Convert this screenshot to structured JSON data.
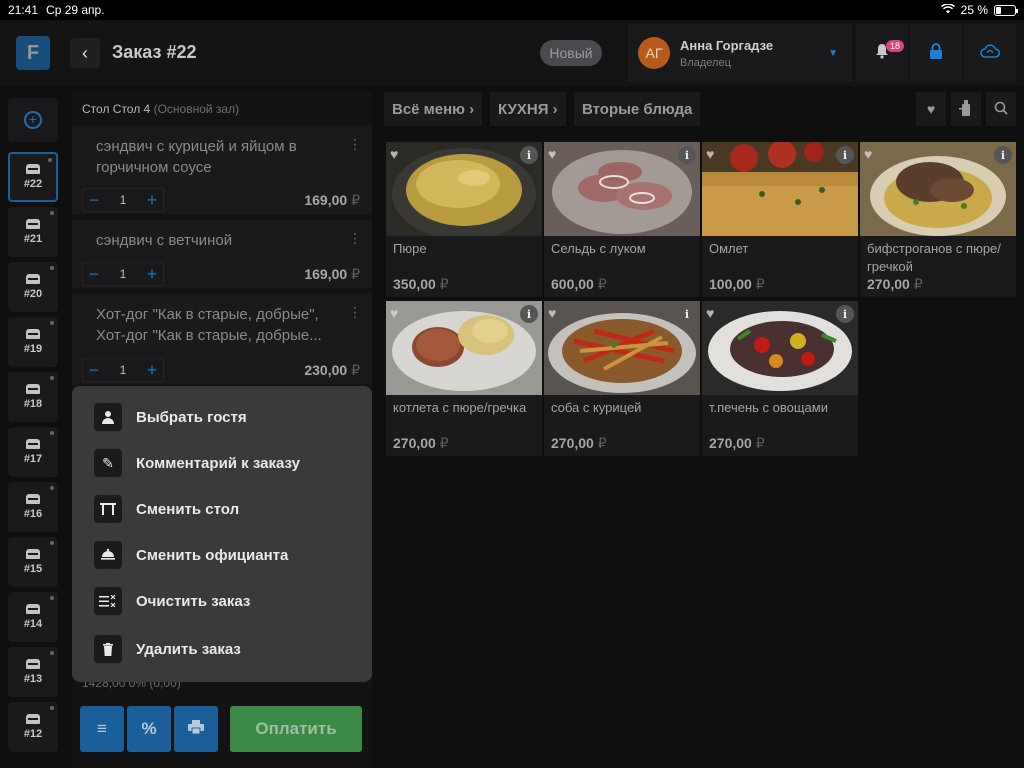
{
  "status_bar": {
    "time": "21:41",
    "date": "Ср 29 апр.",
    "battery": "25 %"
  },
  "header": {
    "logo_letter": "F",
    "back_label": "‹",
    "title": "Заказ #22",
    "status": "Новый",
    "user": {
      "initials": "АГ",
      "name": "Анна Горгадзе",
      "role": "Владелец"
    },
    "notifications_count": "18"
  },
  "tables": [
    {
      "label": "#22",
      "active": true
    },
    {
      "label": "#21"
    },
    {
      "label": "#20"
    },
    {
      "label": "#19"
    },
    {
      "label": "#18"
    },
    {
      "label": "#17"
    },
    {
      "label": "#16"
    },
    {
      "label": "#15"
    },
    {
      "label": "#14"
    },
    {
      "label": "#13"
    },
    {
      "label": "#12"
    }
  ],
  "order": {
    "table_label": "Стол Стол 4",
    "hall": "(Основной зал)",
    "items": [
      {
        "name": "сэндвич с курицей и яйцом в горчичном соусе",
        "qty": "1",
        "price": "169,00"
      },
      {
        "name": "сэндвич с ветчиной",
        "qty": "1",
        "price": "169,00"
      },
      {
        "name": "Хот-дог \"Как в старые, добрые\", Хот-дог \"Как в старые, добрые...",
        "qty": "1",
        "price": "230,00"
      }
    ],
    "currency": "₽",
    "footer_peek": "1428,00      0% (0,00)",
    "pay_label": "Оплатить"
  },
  "context_menu": [
    {
      "icon": "person-icon",
      "label": "Выбрать гостя"
    },
    {
      "icon": "pencil-icon",
      "label": "Комментарий к заказу"
    },
    {
      "icon": "table-icon",
      "label": "Сменить стол"
    },
    {
      "icon": "waiter-icon",
      "label": "Сменить официанта"
    },
    {
      "icon": "clear-list-icon",
      "label": "Очистить заказ"
    },
    {
      "icon": "trash-icon",
      "label": "Удалить заказ"
    }
  ],
  "catalog": {
    "breadcrumb": [
      "Всё меню",
      "КУХНЯ",
      "Вторые блюда"
    ],
    "products": [
      {
        "name": "Пюре",
        "price": "350,00"
      },
      {
        "name": "Сельдь с луком",
        "price": "600,00"
      },
      {
        "name": "Омлет",
        "price": "100,00"
      },
      {
        "name": "бифстроганов с пюре/гречкой",
        "price": "270,00"
      },
      {
        "name": "котлета с пюре/гречка",
        "price": "270,00"
      },
      {
        "name": "соба с курицей",
        "price": "270,00"
      },
      {
        "name": "т.печень с овощами",
        "price": "270,00"
      }
    ]
  },
  "colors": {
    "accent": "#1c7fd1",
    "pay": "#3a8a46",
    "badge": "#d9437b"
  }
}
